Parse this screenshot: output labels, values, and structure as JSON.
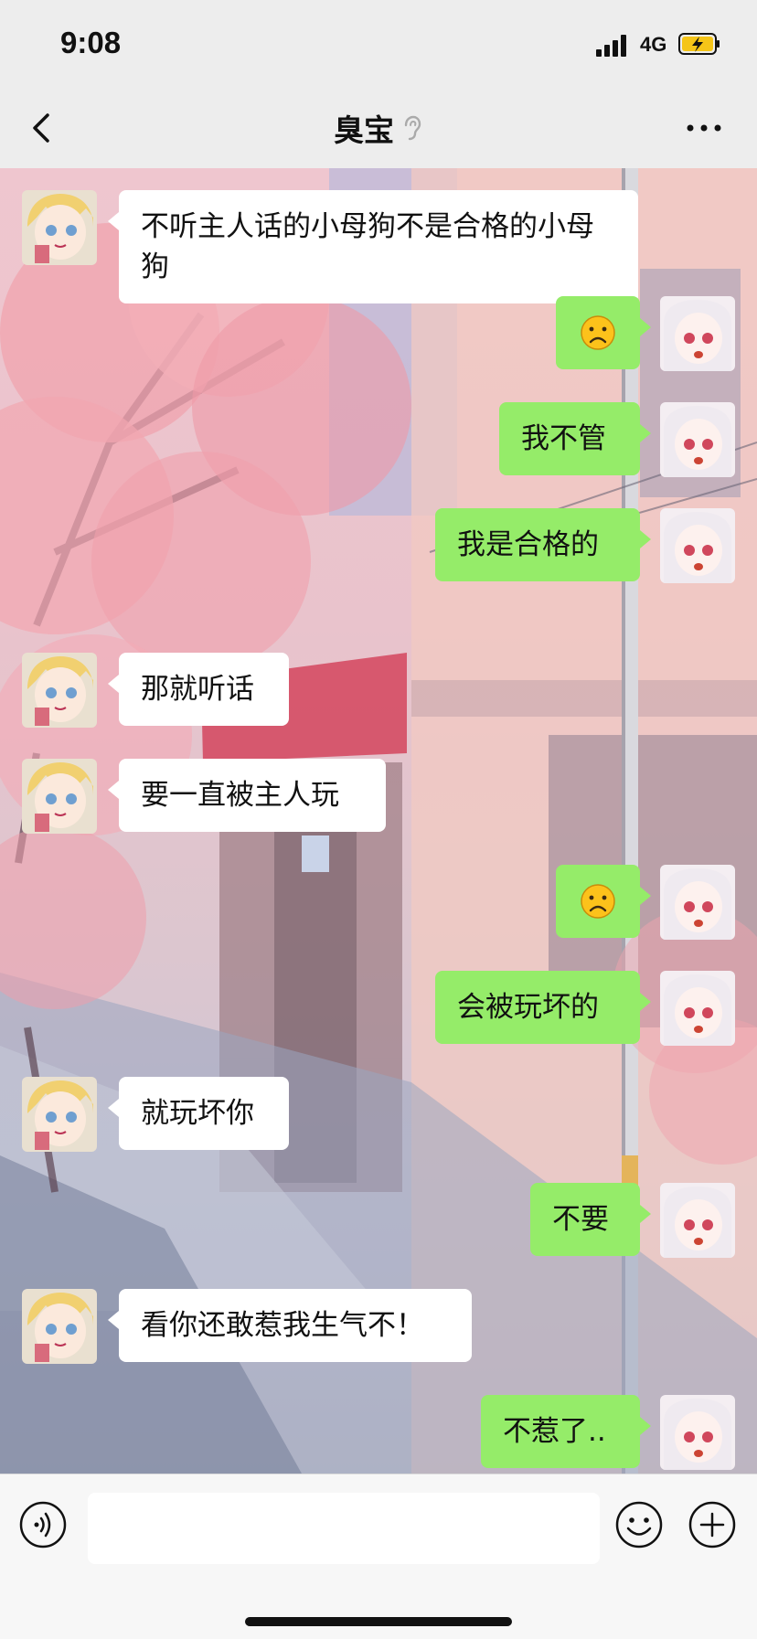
{
  "status_bar": {
    "time": "9:08",
    "network": "4G",
    "battery_icon": "battery-charging-icon",
    "signal_icon": "cellular-signal-icon"
  },
  "nav": {
    "title": "臭宝",
    "back_icon": "chevron-left-icon",
    "mute_icon": "ear-mute-icon",
    "more_icon": "more-dots-icon"
  },
  "messages": [
    {
      "side": "left",
      "text": "不听主人话的小母狗不是合格的小母狗"
    },
    {
      "side": "right",
      "emoji": "frown-emoji"
    },
    {
      "side": "right",
      "text": "我不管"
    },
    {
      "side": "right",
      "text": "我是合格的"
    },
    {
      "side": "left",
      "text": "那就听话"
    },
    {
      "side": "left",
      "text": "要一直被主人玩"
    },
    {
      "side": "right",
      "emoji": "frown-emoji"
    },
    {
      "side": "right",
      "text": "会被玩坏的"
    },
    {
      "side": "left",
      "text": "就玩坏你"
    },
    {
      "side": "right",
      "text": "不要"
    },
    {
      "side": "left",
      "text": "看你还敢惹我生气不！"
    },
    {
      "side": "right",
      "text": "不惹了.."
    }
  ],
  "input_bar": {
    "voice_icon": "voice-icon",
    "emoji_icon": "smile-icon",
    "plus_icon": "plus-circle-icon",
    "input_value": ""
  },
  "colors": {
    "right_bubble": "#95ec69",
    "left_bubble": "#ffffff",
    "bar_bg": "#ededed"
  }
}
